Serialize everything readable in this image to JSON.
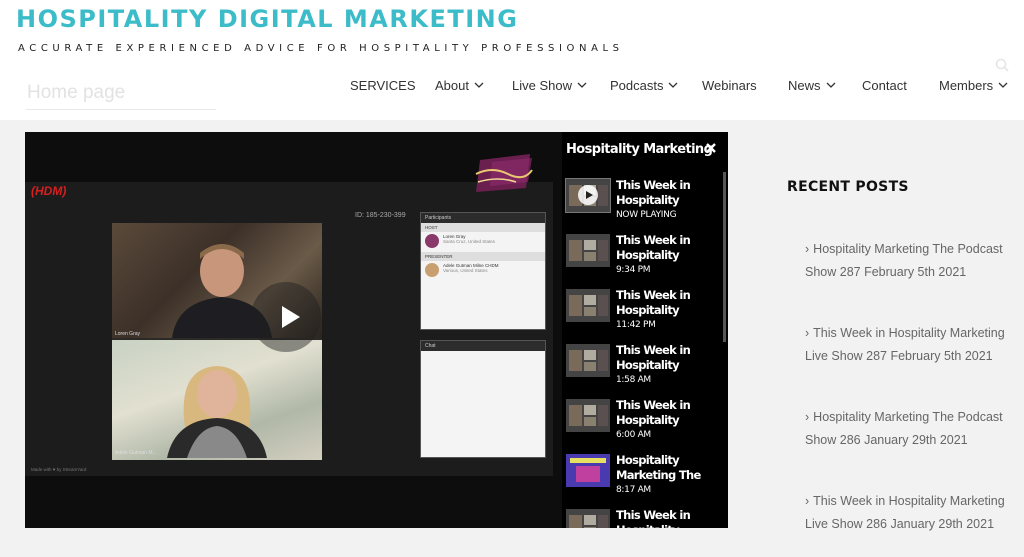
{
  "site": {
    "title": "HOSPITALITY DIGITAL MARKETING",
    "tagline": "ACCURATE EXPERIENCED ADVICE FOR HOSPITALITY PROFESSIONALS"
  },
  "home_field": {
    "placeholder": "Home page"
  },
  "nav": {
    "items": [
      {
        "label": "SERVICES",
        "dropdown": false
      },
      {
        "label": "About",
        "dropdown": true
      },
      {
        "label": "Live Show",
        "dropdown": true
      },
      {
        "label": "Podcasts",
        "dropdown": true
      },
      {
        "label": "Webinars",
        "dropdown": false
      },
      {
        "label": "News",
        "dropdown": true
      },
      {
        "label": "Contact",
        "dropdown": false
      },
      {
        "label": "Members",
        "dropdown": true
      }
    ]
  },
  "player": {
    "stream_id": "ID: 185-230-399",
    "brand": "HDM",
    "participants_header": "Participants",
    "host_label": "HOST",
    "host_name": "Loren Gray",
    "host_location": "Santa Cruz, United States",
    "presenter_label": "PRESENTER",
    "presenter_name": "Adele Gutman Milne CHDM",
    "presenter_location": "Various, United States",
    "chat_header": "Chat",
    "video_label_1": "Loren Gray",
    "video_label_2": "Adele Gutman M...",
    "made_with": "Made with ♥ by StreamYard"
  },
  "playlist": {
    "title": "Hospitality Marketing",
    "items": [
      {
        "name": "This Week in Hospitality",
        "time": "NOW PLAYING",
        "active": true
      },
      {
        "name": "This Week in Hospitality",
        "time": "9:34 PM",
        "active": false
      },
      {
        "name": "This Week in Hospitality",
        "time": "11:42 PM",
        "active": false
      },
      {
        "name": "This Week in Hospitality",
        "time": "1:58 AM",
        "active": false
      },
      {
        "name": "This Week in Hospitality",
        "time": "6:00 AM",
        "active": false
      },
      {
        "name": "Hospitality Marketing The",
        "time": "8:17 AM",
        "active": false
      },
      {
        "name": "This Week in Hospitality",
        "time": "",
        "active": false
      }
    ]
  },
  "recent_posts": {
    "title": "RECENT POSTS",
    "posts": [
      "Hospitality Marketing The Podcast Show 287 February 5th 2021",
      "This Week in Hospitality Marketing Live Show 287 February 5th 2021",
      "Hospitality Marketing The Podcast Show 286 January 29th 2021",
      "This Week in Hospitality Marketing Live Show 286 January 29th 2021"
    ]
  },
  "colors": {
    "brand": "#3cbcc9",
    "player_bg": "#000000",
    "page_bg": "#f2f2f2"
  }
}
